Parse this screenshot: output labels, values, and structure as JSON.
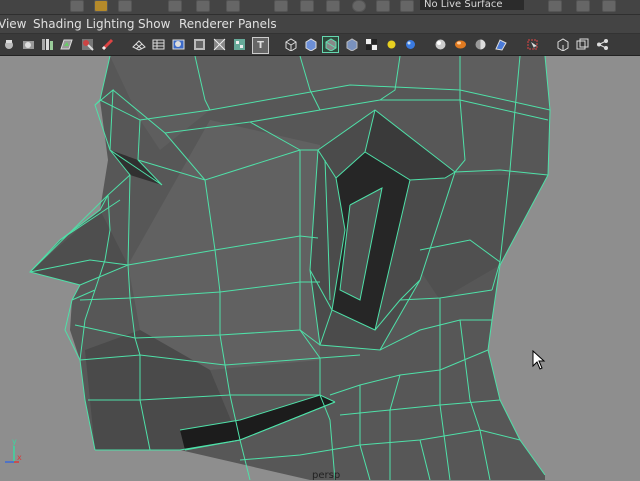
{
  "topbar": {
    "surface_field": "No Live Surface"
  },
  "menu": {
    "items": [
      "View",
      "Shading",
      "Lighting",
      "Show",
      "Renderer",
      "Panels"
    ]
  },
  "toolbar": {
    "text_icon_glyph": "T"
  },
  "viewport": {
    "camera_label": "persp",
    "wire_color": "#4fe0a8",
    "background_color": "#8e8e8e"
  },
  "axis": {
    "y_label": "y",
    "x_label": "x"
  }
}
